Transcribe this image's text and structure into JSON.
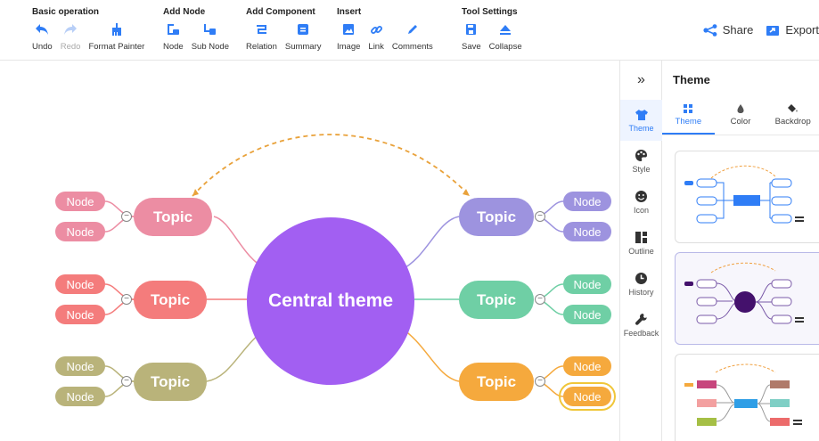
{
  "toolbar": {
    "groups": [
      {
        "title": "Basic operation",
        "items": [
          {
            "label": "Undo",
            "icon": "undo-icon"
          },
          {
            "label": "Redo",
            "icon": "redo-icon"
          },
          {
            "label": "Format Painter",
            "icon": "format-painter-icon"
          }
        ]
      },
      {
        "title": "Add Node",
        "items": [
          {
            "label": "Node",
            "icon": "add-node-icon"
          },
          {
            "label": "Sub Node",
            "icon": "sub-node-icon"
          }
        ]
      },
      {
        "title": "Add Component",
        "items": [
          {
            "label": "Relation",
            "icon": "relation-icon"
          },
          {
            "label": "Summary",
            "icon": "summary-icon"
          }
        ]
      },
      {
        "title": "Insert",
        "items": [
          {
            "label": "Image",
            "icon": "image-icon"
          },
          {
            "label": "Link",
            "icon": "link-icon"
          },
          {
            "label": "Comments",
            "icon": "comments-icon"
          }
        ]
      },
      {
        "title": "Tool Settings",
        "items": [
          {
            "label": "Save",
            "icon": "save-icon"
          },
          {
            "label": "Collapse",
            "icon": "collapse-icon"
          }
        ]
      }
    ],
    "share_label": "Share",
    "export_label": "Export"
  },
  "mindmap": {
    "central": "Central theme",
    "topics": [
      {
        "label": "Topic",
        "color": "#ec8da3",
        "nodes": [
          "Node",
          "Node"
        ]
      },
      {
        "label": "Topic",
        "color": "#f47c7c",
        "nodes": [
          "Node",
          "Node"
        ]
      },
      {
        "label": "Topic",
        "color": "#b9b37a",
        "nodes": [
          "Node",
          "Node"
        ]
      },
      {
        "label": "Topic",
        "color": "#9d93df",
        "nodes": [
          "Node",
          "Node"
        ]
      },
      {
        "label": "Topic",
        "color": "#6fcfa5",
        "nodes": [
          "Node",
          "Node"
        ]
      },
      {
        "label": "Topic",
        "color": "#f5a93d",
        "nodes": [
          "Node",
          "Node"
        ]
      }
    ],
    "relation_color": "#e9a23b",
    "central_color": "#a25ff2"
  },
  "rail": {
    "toggle": "»",
    "items": [
      {
        "label": "Theme",
        "icon": "shirt-icon"
      },
      {
        "label": "Style",
        "icon": "palette-icon"
      },
      {
        "label": "Icon",
        "icon": "smiley-icon"
      },
      {
        "label": "Outline",
        "icon": "outline-icon"
      },
      {
        "label": "History",
        "icon": "clock-icon"
      },
      {
        "label": "Feedback",
        "icon": "wrench-icon"
      }
    ]
  },
  "panel": {
    "title": "Theme",
    "tabs": [
      {
        "label": "Theme",
        "icon": "grid-icon"
      },
      {
        "label": "Color",
        "icon": "color-drop-icon"
      },
      {
        "label": "Backdrop",
        "icon": "paint-bucket-icon"
      }
    ]
  },
  "colors": {
    "accent": "#2f7df6",
    "text": "#333333"
  }
}
